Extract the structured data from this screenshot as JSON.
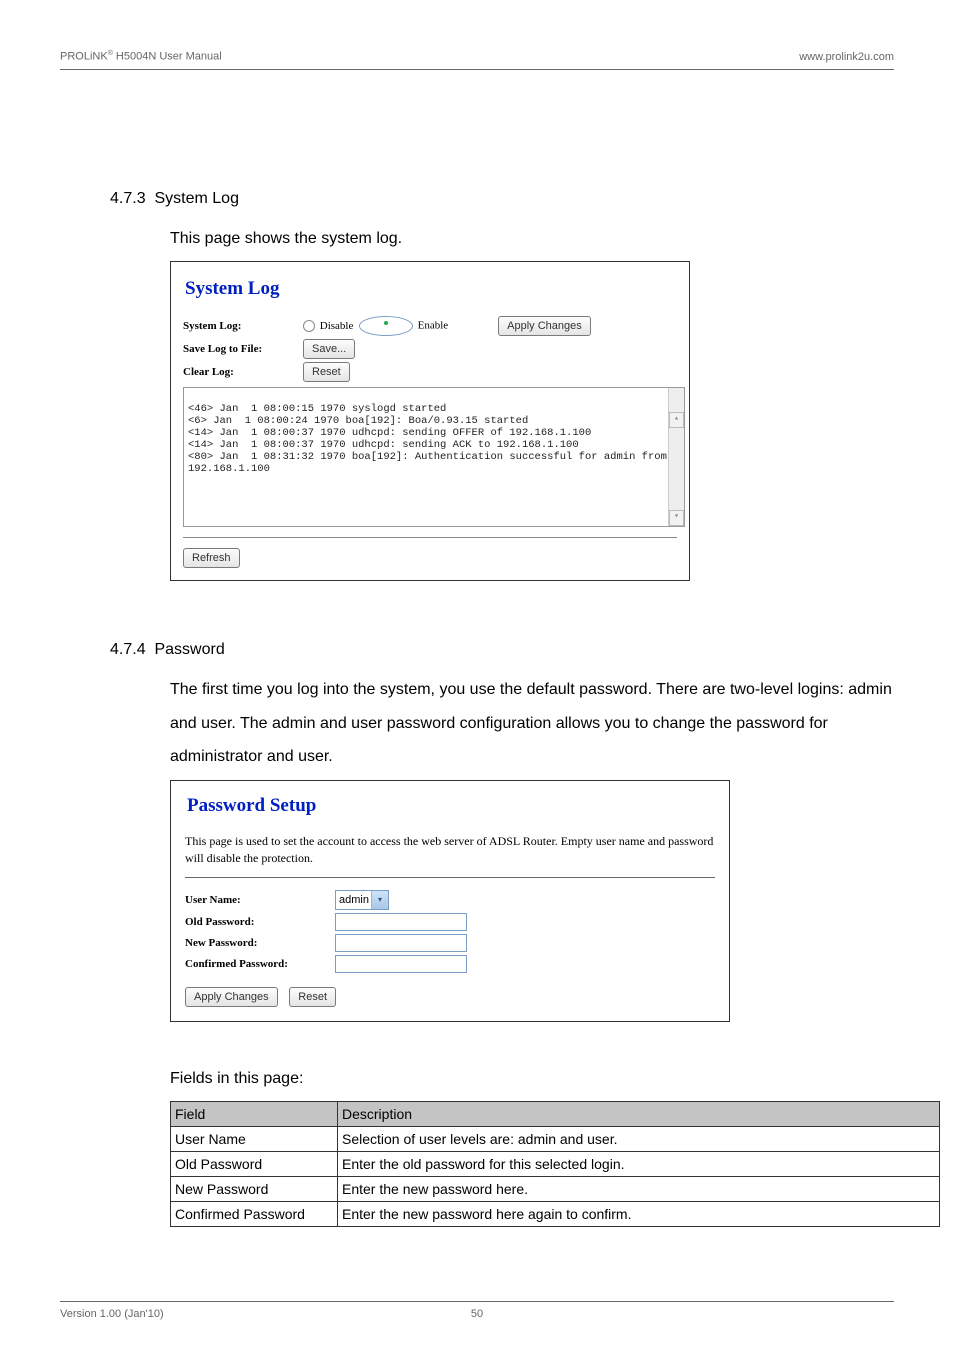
{
  "header": {
    "left_prefix": "PROLiNK",
    "left_suffix": " H5004N User Manual",
    "right": "www.prolink2u.com"
  },
  "section1": {
    "number": "4.7.3",
    "title": "System Log",
    "intro": "This page shows the system log.",
    "shot": {
      "title": "System Log",
      "rows": {
        "syslog_label": "System Log:",
        "disable_label": "Disable",
        "enable_label": "Enable",
        "apply_btn": "Apply Changes",
        "savefile_label": "Save Log to File:",
        "save_btn": "Save...",
        "clearlog_label": "Clear Log:",
        "reset_btn": "Reset"
      },
      "log_text": "<46> Jan  1 08:00:15 1970 syslogd started\n<6> Jan  1 08:00:24 1970 boa[192]: Boa/0.93.15 started\n<14> Jan  1 08:00:37 1970 udhcpd: sending OFFER of 192.168.1.100\n<14> Jan  1 08:00:37 1970 udhcpd: sending ACK to 192.168.1.100\n<80> Jan  1 08:31:32 1970 boa[192]: Authentication successful for admin from\n192.168.1.100",
      "refresh_btn": "Refresh"
    }
  },
  "section2": {
    "number": "4.7.4",
    "title": "Password",
    "intro": "The first time you log into the system, you use the default password. There are two-level logins: admin and user. The admin and user password configuration allows you to change the password for administrator and user.",
    "shot": {
      "title": "Password Setup",
      "desc": "This page is used to set the account to access the web server of ADSL Router. Empty user name and password will disable the protection.",
      "labels": {
        "username": "User Name:",
        "oldpw": "Old Password:",
        "newpw": "New Password:",
        "confpw": "Confirmed Password:"
      },
      "username_value": "admin",
      "apply_btn": "Apply Changes",
      "reset_btn": "Reset"
    },
    "fields_heading": "Fields in this page:",
    "table": {
      "head": {
        "field": "Field",
        "desc": "Description"
      },
      "rows": [
        {
          "field": "User Name",
          "desc": "Selection of user levels are: admin and user."
        },
        {
          "field": "Old Password",
          "desc": "Enter the old password for this selected login."
        },
        {
          "field": "New Password",
          "desc": "Enter the new password here."
        },
        {
          "field": "Confirmed Password",
          "desc": "Enter the new password here again to confirm."
        }
      ]
    }
  },
  "footer": {
    "left": "Version 1.00 (Jan'10)",
    "page": "50"
  }
}
